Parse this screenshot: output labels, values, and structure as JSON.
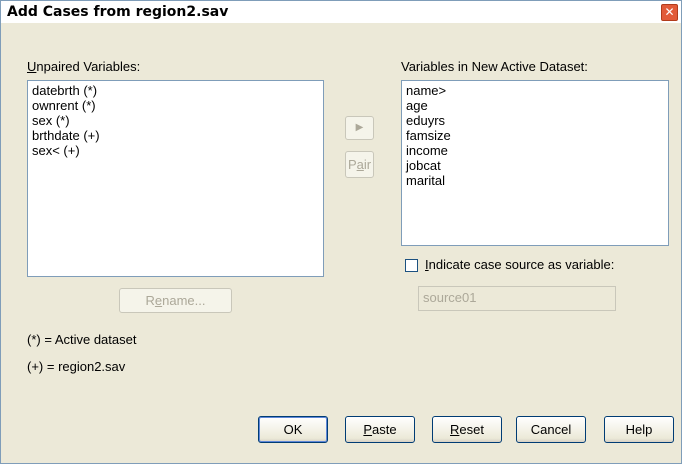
{
  "window": {
    "title": "Add Cases from region2.sav",
    "close_glyph": "✕"
  },
  "unpaired": {
    "label_key": "U",
    "label_rest": "npaired Variables:",
    "items": [
      "datebrth (*)",
      "ownrent (*)",
      "sex (*)",
      "brthdate (+)",
      "sex< (+)"
    ]
  },
  "new_dataset": {
    "label": "Variables in New Active Dataset:",
    "items": [
      "name>",
      "age",
      "eduyrs",
      "famsize",
      "income",
      "jobcat",
      "marital"
    ]
  },
  "move_button": {
    "glyph": "▶"
  },
  "pair_button": {
    "pre": "P",
    "key": "a",
    "post": "ir"
  },
  "rename_button": {
    "pre": "R",
    "key": "e",
    "post": "name..."
  },
  "indicate_source": {
    "key": "I",
    "rest": "ndicate case source as variable:",
    "checked": false,
    "value": "source01"
  },
  "legend": {
    "active": "(*) = Active dataset",
    "other": "(+) = region2.sav"
  },
  "footer": {
    "ok": "OK",
    "paste_key": "P",
    "paste_rest": "aste",
    "reset_key": "R",
    "reset_rest": "eset",
    "cancel": "Cancel",
    "help": "Help"
  }
}
